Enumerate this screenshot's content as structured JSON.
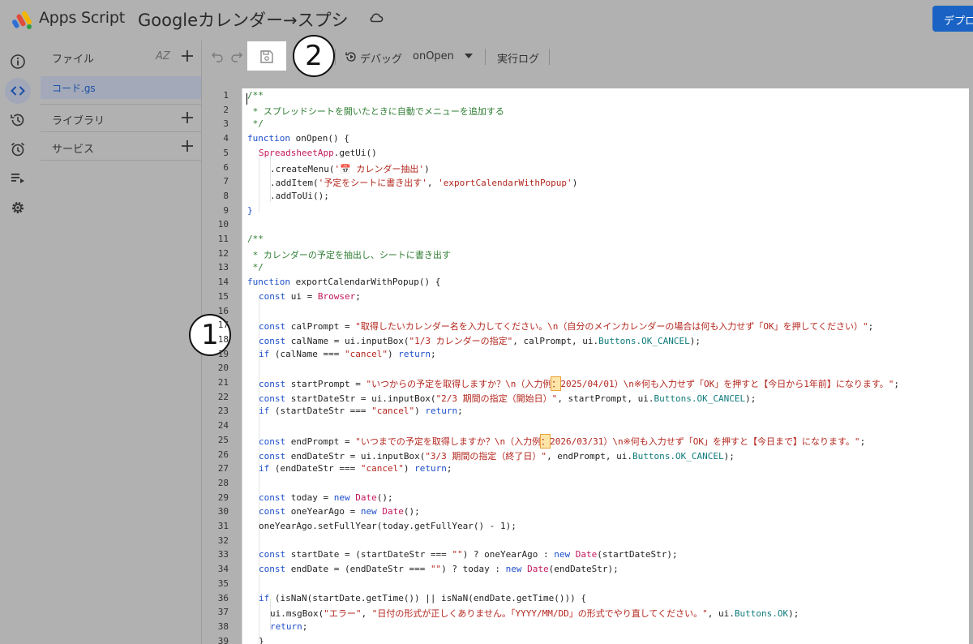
{
  "header": {
    "brand": "Apps Script",
    "project_title": "Googleカレンダー→スプシ",
    "deploy_label": "デプロ"
  },
  "rail": {
    "icons": [
      "info-icon",
      "code-icon",
      "history-icon",
      "alarm-icon",
      "executions-icon",
      "gear-icon"
    ],
    "active": "code-icon"
  },
  "files_panel": {
    "files_label": "ファイル",
    "sort_label": "AZ",
    "file_name": "コード.gs",
    "libraries_label": "ライブラリ",
    "services_label": "サービス"
  },
  "toolbar": {
    "debug_label": "デバッグ",
    "function_name": "onOpen",
    "log_label": "実行ログ"
  },
  "callouts": {
    "one": "1",
    "two": "2"
  },
  "colors": {
    "background": "#b1b1b1",
    "accent": "#1a63c4",
    "keyword": "#1e4fc9",
    "string": "#b3261e",
    "comment": "#2e7d32",
    "function": "#c2185b"
  },
  "code": {
    "line_numbers": [
      "1",
      "2",
      "3",
      "4",
      "5",
      "6",
      "7",
      "8",
      "9",
      "10",
      "11",
      "12",
      "13",
      "14",
      "15",
      "16",
      "17",
      "18",
      "19",
      "20",
      "21",
      "22",
      "23",
      "24",
      "25",
      "26",
      "27",
      "28",
      "29",
      "30",
      "31",
      "32",
      "33",
      "34",
      "35",
      "36",
      "37",
      "38",
      "39"
    ],
    "l1": "/**",
    "l2": " * スプレッドシートを開いたときに自動でメニューを追加する",
    "l3": " */",
    "l4_kw": "function",
    "l4_rest": " onOpen() {",
    "l5_obj": "SpreadsheetApp",
    "l5_rest": ".getUi()",
    "l6_a": ".createMenu(",
    "l6_s": "'📅 カレンダー抽出'",
    "l6_b": ")",
    "l7_a": ".addItem(",
    "l7_s1": "'予定をシートに書き出す'",
    "l7_b": ", ",
    "l7_s2": "'exportCalendarWithPopup'",
    "l7_c": ")",
    "l8": ".addToUi();",
    "l9": "}",
    "l11": "/**",
    "l12": " * カレンダーの予定を抽出し、シートに書き出す",
    "l13": " */",
    "l14_kw": "function",
    "l14_rest": " exportCalendarWithPopup() {",
    "l15_kw": "const",
    "l15_a": " ui = ",
    "l15_fn": "Browser",
    "l15_b": ";",
    "l17_kw": "const",
    "l17_a": " calPrompt = ",
    "l17_s": "\"取得したいカレンダー名を入力してください。\\n（自分のメインカレンダーの場合は何も入力せず「OK」を押してください）\"",
    "l17_b": ";",
    "l18_kw": "const",
    "l18_a": " calName = ui.inputBox(",
    "l18_s": "\"1/3 カレンダーの指定\"",
    "l18_b": ", calPrompt, ui.",
    "l18_p": "Buttons.OK_CANCEL",
    "l18_c": ");",
    "l19_kw": "if",
    "l19_a": " (calName === ",
    "l19_s": "\"cancel\"",
    "l19_b": ") ",
    "l19_kw2": "return",
    "l19_c": ";",
    "l21_kw": "const",
    "l21_a": " startPrompt = ",
    "l21_s1": "\"いつからの予定を取得しますか？\\n（入力例",
    "l21_h": "：",
    "l21_s2": "2025/04/01）\\n※何も入力せず「OK」を押すと【今日から1年前】になります。\"",
    "l21_b": ";",
    "l22_kw": "const",
    "l22_a": " startDateStr = ui.inputBox(",
    "l22_s": "\"2/3 期間の指定（開始日）\"",
    "l22_b": ", startPrompt, ui.",
    "l22_p": "Buttons.OK_CANCEL",
    "l22_c": ");",
    "l23_kw": "if",
    "l23_a": " (startDateStr === ",
    "l23_s": "\"cancel\"",
    "l23_b": ") ",
    "l23_kw2": "return",
    "l23_c": ";",
    "l25_kw": "const",
    "l25_a": " endPrompt = ",
    "l25_s1": "\"いつまでの予定を取得しますか？\\n（入力例",
    "l25_h": "：",
    "l25_s2": "2026/03/31）\\n※何も入力せず「OK」を押すと【今日まで】になります。\"",
    "l25_b": ";",
    "l26_kw": "const",
    "l26_a": " endDateStr = ui.inputBox(",
    "l26_s": "\"3/3 期間の指定（終了日）\"",
    "l26_b": ", endPrompt, ui.",
    "l26_p": "Buttons.OK_CANCEL",
    "l26_c": ");",
    "l27_kw": "if",
    "l27_a": " (endDateStr === ",
    "l27_s": "\"cancel\"",
    "l27_b": ") ",
    "l27_kw2": "return",
    "l27_c": ";",
    "l29_kw": "const",
    "l29_a": " today = ",
    "l29_kw2": "new",
    "l29_sp": " ",
    "l29_fn": "Date",
    "l29_b": "();",
    "l30_kw": "const",
    "l30_a": " oneYearAgo = ",
    "l30_kw2": "new",
    "l30_sp": " ",
    "l30_fn": "Date",
    "l30_b": "();",
    "l31": "oneYearAgo.setFullYear(today.getFullYear() - 1);",
    "l33_kw": "const",
    "l33_a": " startDate = (startDateStr === ",
    "l33_s": "\"\"",
    "l33_b": ") ? oneYearAgo : ",
    "l33_kw2": "new",
    "l33_sp": " ",
    "l33_fn": "Date",
    "l33_c": "(startDateStr);",
    "l34_kw": "const",
    "l34_a": " endDate = (endDateStr === ",
    "l34_s": "\"\"",
    "l34_b": ") ? today : ",
    "l34_kw2": "new",
    "l34_sp": " ",
    "l34_fn": "Date",
    "l34_c": "(endDateStr);",
    "l36_kw": "if",
    "l36_a": " (isNaN(startDate.getTime()) || isNaN(endDate.getTime())) {",
    "l37_a": "ui.msgBox(",
    "l37_s1": "\"エラー\"",
    "l37_b": ", ",
    "l37_s2": "\"日付の形式が正しくありません。「YYYY/MM/DD」の形式でやり直してください。\"",
    "l37_c": ", ui.",
    "l37_p": "Buttons.OK",
    "l37_d": ");",
    "l38_kw": "return",
    "l38_a": ";",
    "l39": "}"
  }
}
